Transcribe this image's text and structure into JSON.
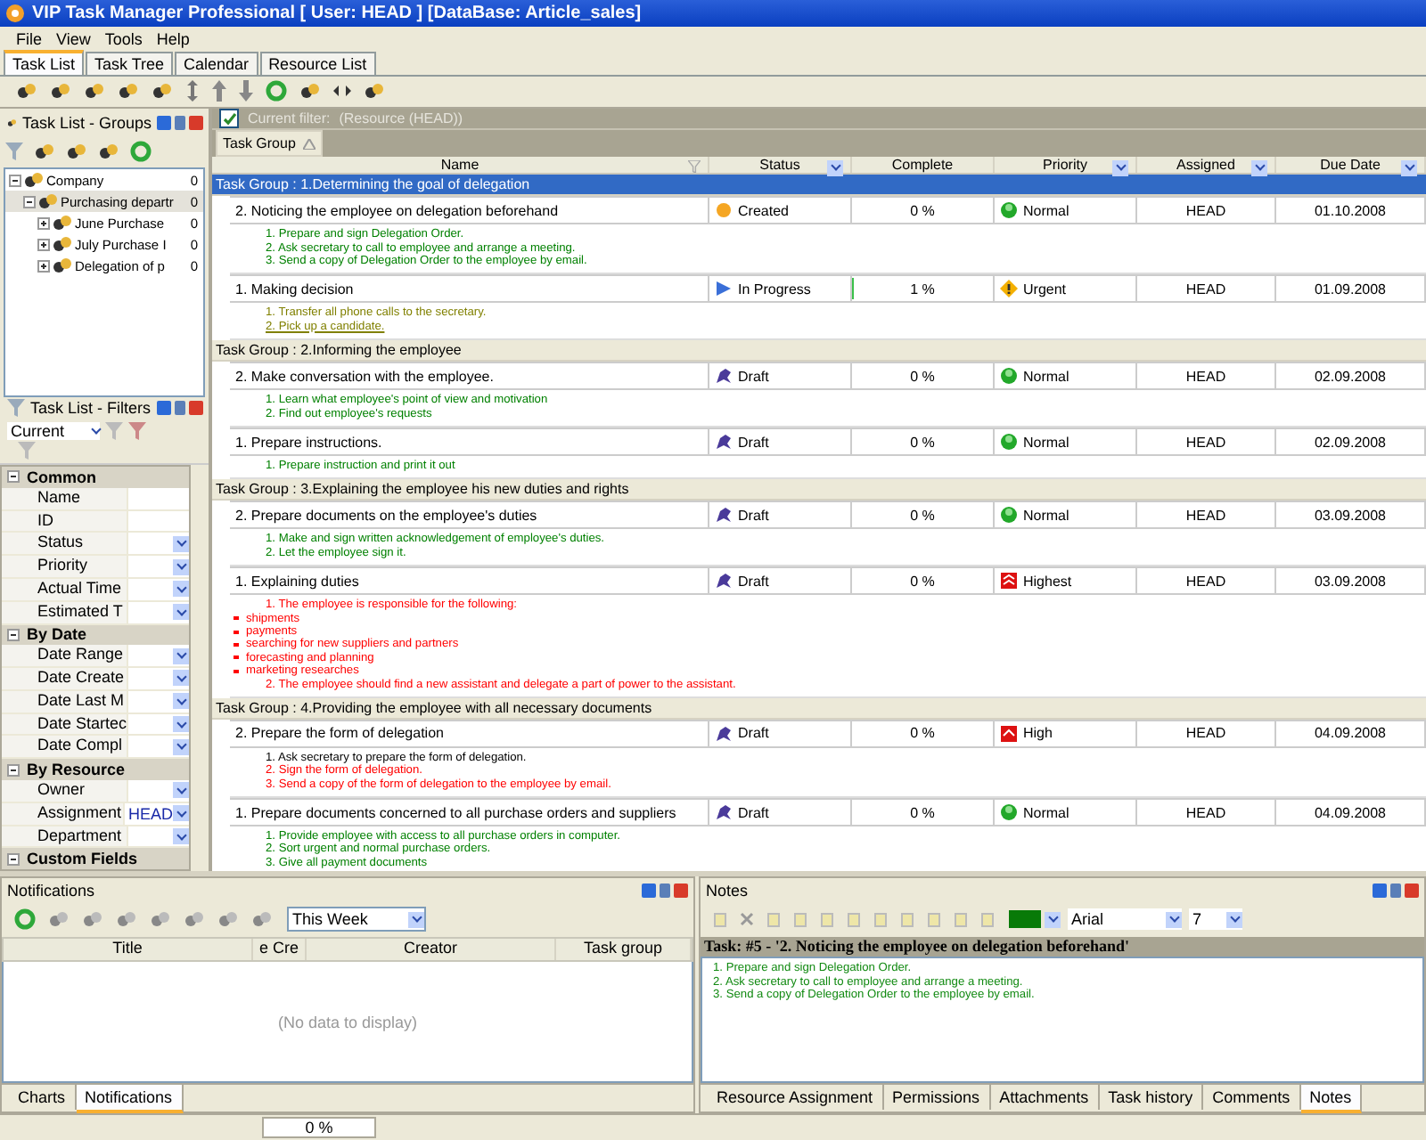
{
  "window": {
    "title": "VIP Task Manager Professional [ User: HEAD ] [DataBase: Article_sales]"
  },
  "menu": [
    "File",
    "View",
    "Tools",
    "Help"
  ],
  "tabs": [
    {
      "label": "Task List",
      "selected": true
    },
    {
      "label": "Task Tree",
      "selected": false
    },
    {
      "label": "Calendar",
      "selected": false
    },
    {
      "label": "Resource List",
      "selected": false
    }
  ],
  "groups_panel": {
    "title": "Task List - Groups",
    "tree": [
      {
        "label": "Company",
        "count": "0",
        "expanded": true,
        "selected": false,
        "children": [
          {
            "label": "Purchasing departr",
            "count": "0",
            "expanded": true,
            "selected": true,
            "children": [
              {
                "label": "June Purchase",
                "count": "0",
                "expanded": false,
                "selected": false
              },
              {
                "label": "July Purchase I",
                "count": "0",
                "expanded": false,
                "selected": false
              },
              {
                "label": "Delegation of p",
                "count": "0",
                "expanded": false,
                "selected": false
              }
            ]
          }
        ]
      }
    ]
  },
  "filters_panel": {
    "title": "Task List - Filters",
    "view": "Current",
    "sections": [
      {
        "title": "Common",
        "expanded": true,
        "rows": [
          {
            "label": "Name",
            "kind": "text"
          },
          {
            "label": "ID",
            "kind": "text"
          },
          {
            "label": "Status",
            "kind": "dropdown"
          },
          {
            "label": "Priority",
            "kind": "dropdown"
          },
          {
            "label": "Actual Time",
            "kind": "dropdown"
          },
          {
            "label": "Estimated T",
            "kind": "dropdown"
          }
        ]
      },
      {
        "title": "By Date",
        "expanded": true,
        "rows": [
          {
            "label": "Date Range",
            "kind": "dropdown"
          },
          {
            "label": "Date Create",
            "kind": "dropdown"
          },
          {
            "label": "Date Last M",
            "kind": "dropdown"
          },
          {
            "label": "Date Startec",
            "kind": "dropdown"
          },
          {
            "label": "Date Compl",
            "kind": "dropdown"
          }
        ]
      },
      {
        "title": "By Resource",
        "expanded": true,
        "rows": [
          {
            "label": "Owner",
            "kind": "dropdown"
          },
          {
            "label": "Assignment",
            "kind": "dropdown",
            "value": "HEAD"
          },
          {
            "label": "Department",
            "kind": "dropdown"
          }
        ]
      },
      {
        "title": "Custom Fields",
        "expanded": true
      }
    ]
  },
  "filter_bar": {
    "checked": true,
    "label": "Current filter:",
    "value": "(Resource (HEAD))"
  },
  "group_by": "Task Group",
  "columns": [
    {
      "label": "Name",
      "kind": "filter"
    },
    {
      "label": "Status",
      "kind": "dropdown"
    },
    {
      "label": "Complete",
      "kind": "plain"
    },
    {
      "label": "Priority",
      "kind": "dropdown"
    },
    {
      "label": "Assigned",
      "kind": "dropdown"
    },
    {
      "label": "Due Date",
      "kind": "dropdown"
    }
  ],
  "groups": [
    {
      "title": "Task Group : 1.Determining the goal of delegation",
      "selected": true,
      "tasks": [
        {
          "name": "2. Noticing the employee on delegation beforehand",
          "status": {
            "label": "Created",
            "kind": "created"
          },
          "complete": "0 %",
          "priority": {
            "label": "Normal",
            "kind": "normal"
          },
          "assigned": "HEAD",
          "due": "01.10.2008",
          "notes": [
            {
              "text": "1. Prepare and sign Delegation Order.",
              "kind": "item",
              "color": "#008000"
            },
            {
              "text": "2. Ask secretary to call to employee and arrange a meeting.",
              "kind": "item",
              "color": "#008000"
            },
            {
              "text": "3. Send a copy of Delegation Order to the employee by email.",
              "kind": "item",
              "color": "#008000"
            }
          ]
        },
        {
          "name": "1. Making decision",
          "status": {
            "label": "In Progress",
            "kind": "in_progress"
          },
          "complete": "1 %",
          "level": 0.01,
          "priority": {
            "label": "Urgent",
            "kind": "urgent"
          },
          "assigned": "HEAD",
          "due": "01.09.2008",
          "notes": [
            {
              "text": "1. Transfer all phone calls to the secretary.",
              "kind": "item",
              "color": "#808000"
            },
            {
              "text": "2. Pick up a candidate.",
              "kind": "link",
              "color": "#808000"
            }
          ]
        }
      ]
    },
    {
      "title": "Task Group : 2.Informing the employee",
      "selected": false,
      "tasks": [
        {
          "name": "2. Make conversation with the employee.",
          "status": {
            "label": "Draft",
            "kind": "draft"
          },
          "complete": "0 %",
          "priority": {
            "label": "Normal",
            "kind": "normal"
          },
          "assigned": "HEAD",
          "due": "02.09.2008",
          "notes": [
            {
              "text": "1. Learn what employee's point of view and motivation",
              "kind": "item",
              "color": "#008000"
            },
            {
              "text": "2. Find out employee's requests",
              "kind": "item",
              "color": "#008000"
            }
          ]
        },
        {
          "name": "1. Prepare instructions.",
          "status": {
            "label": "Draft",
            "kind": "draft"
          },
          "complete": "0 %",
          "priority": {
            "label": "Normal",
            "kind": "normal"
          },
          "assigned": "HEAD",
          "due": "02.09.2008",
          "notes": [
            {
              "text": "1. Prepare instruction and print it out",
              "kind": "item",
              "color": "#008000"
            }
          ]
        }
      ]
    },
    {
      "title": "Task Group : 3.Explaining the employee his new duties and rights",
      "selected": false,
      "tasks": [
        {
          "name": "2. Prepare documents on the employee's duties",
          "status": {
            "label": "Draft",
            "kind": "draft"
          },
          "complete": "0 %",
          "priority": {
            "label": "Normal",
            "kind": "normal"
          },
          "assigned": "HEAD",
          "due": "03.09.2008",
          "notes": [
            {
              "text": "1. Make and sign written acknowledgement of employee's duties.",
              "kind": "item",
              "color": "#008000"
            },
            {
              "text": "2. Let the employee sign it.",
              "kind": "item",
              "color": "#008000"
            }
          ]
        },
        {
          "name": "1. Explaining duties",
          "status": {
            "label": "Draft",
            "kind": "draft"
          },
          "complete": "0 %",
          "priority": {
            "label": "Highest",
            "kind": "highest"
          },
          "assigned": "HEAD",
          "due": "03.09.2008",
          "notes": [
            {
              "text": "1. The employee is responsible for the following:",
              "kind": "item",
              "color": "#ff0000"
            },
            {
              "text": "shipments",
              "kind": "bullet",
              "color": "#ff0000"
            },
            {
              "text": "payments",
              "kind": "bullet",
              "color": "#ff0000"
            },
            {
              "text": "searching for new suppliers and partners",
              "kind": "bullet",
              "color": "#ff0000"
            },
            {
              "text": "forecasting and planning",
              "kind": "bullet",
              "color": "#ff0000"
            },
            {
              "text": "marketing researches",
              "kind": "bullet",
              "color": "#ff0000"
            },
            {
              "text": "2. The employee should find a new assistant and delegate a part of power to the assistant.",
              "kind": "item",
              "color": "#ff0000"
            }
          ]
        }
      ]
    },
    {
      "title": "Task Group : 4.Providing the employee with all necessary documents",
      "selected": false,
      "tasks": [
        {
          "name": "2. Prepare the form of delegation",
          "status": {
            "label": "Draft",
            "kind": "draft"
          },
          "complete": "0 %",
          "priority": {
            "label": "High",
            "kind": "high"
          },
          "assigned": "HEAD",
          "due": "04.09.2008",
          "notes": [
            {
              "text": "1. Ask secretary to prepare the form of delegation.",
              "kind": "item",
              "color": "#000000"
            },
            {
              "text": "2. Sign the form of delegation.",
              "kind": "item",
              "color": "#ff0000"
            },
            {
              "text": "3. Send a copy of the form of delegation to the employee by email.",
              "kind": "item",
              "color": "#ff0000"
            }
          ]
        },
        {
          "name": "1. Prepare documents concerned to all purchase orders and suppliers",
          "status": {
            "label": "Draft",
            "kind": "draft"
          },
          "complete": "0 %",
          "priority": {
            "label": "Normal",
            "kind": "normal"
          },
          "assigned": "HEAD",
          "due": "04.09.2008",
          "notes": [
            {
              "text": "1. Provide employee with access to all purchase orders in computer.",
              "kind": "item",
              "color": "#008000"
            },
            {
              "text": "2. Sort urgent and normal purchase orders.",
              "kind": "item",
              "color": "#008000"
            },
            {
              "text": "3. Give all payment documents",
              "kind": "item",
              "color": "#008000"
            }
          ]
        }
      ]
    }
  ],
  "notifications": {
    "title": "Notifications",
    "period": "This Week",
    "columns": [
      "Title",
      "e Cre",
      "Creator",
      "Task group"
    ],
    "empty": "(No data to display)"
  },
  "notes_panel": {
    "title": "Notes",
    "font": "Arial",
    "size": "7",
    "heading": "Task: #5 - '2. Noticing the employee on delegation beforehand'",
    "lines": [
      "1. Prepare and sign Delegation Order.",
      "2. Ask secretary to call to employee and arrange a meeting.",
      "3. Send a copy of Delegation Order to the employee by email."
    ]
  },
  "left_tabs": [
    {
      "label": "Charts",
      "selected": false
    },
    {
      "label": "Notifications",
      "selected": true
    }
  ],
  "right_tabs": [
    {
      "label": "Resource Assignment",
      "selected": false
    },
    {
      "label": "Permissions",
      "selected": false
    },
    {
      "label": "Attachments",
      "selected": false
    },
    {
      "label": "Task history",
      "selected": false
    },
    {
      "label": "Comments",
      "selected": false
    },
    {
      "label": "Notes",
      "selected": true
    }
  ],
  "status_bar": {
    "progress": "0 %"
  }
}
